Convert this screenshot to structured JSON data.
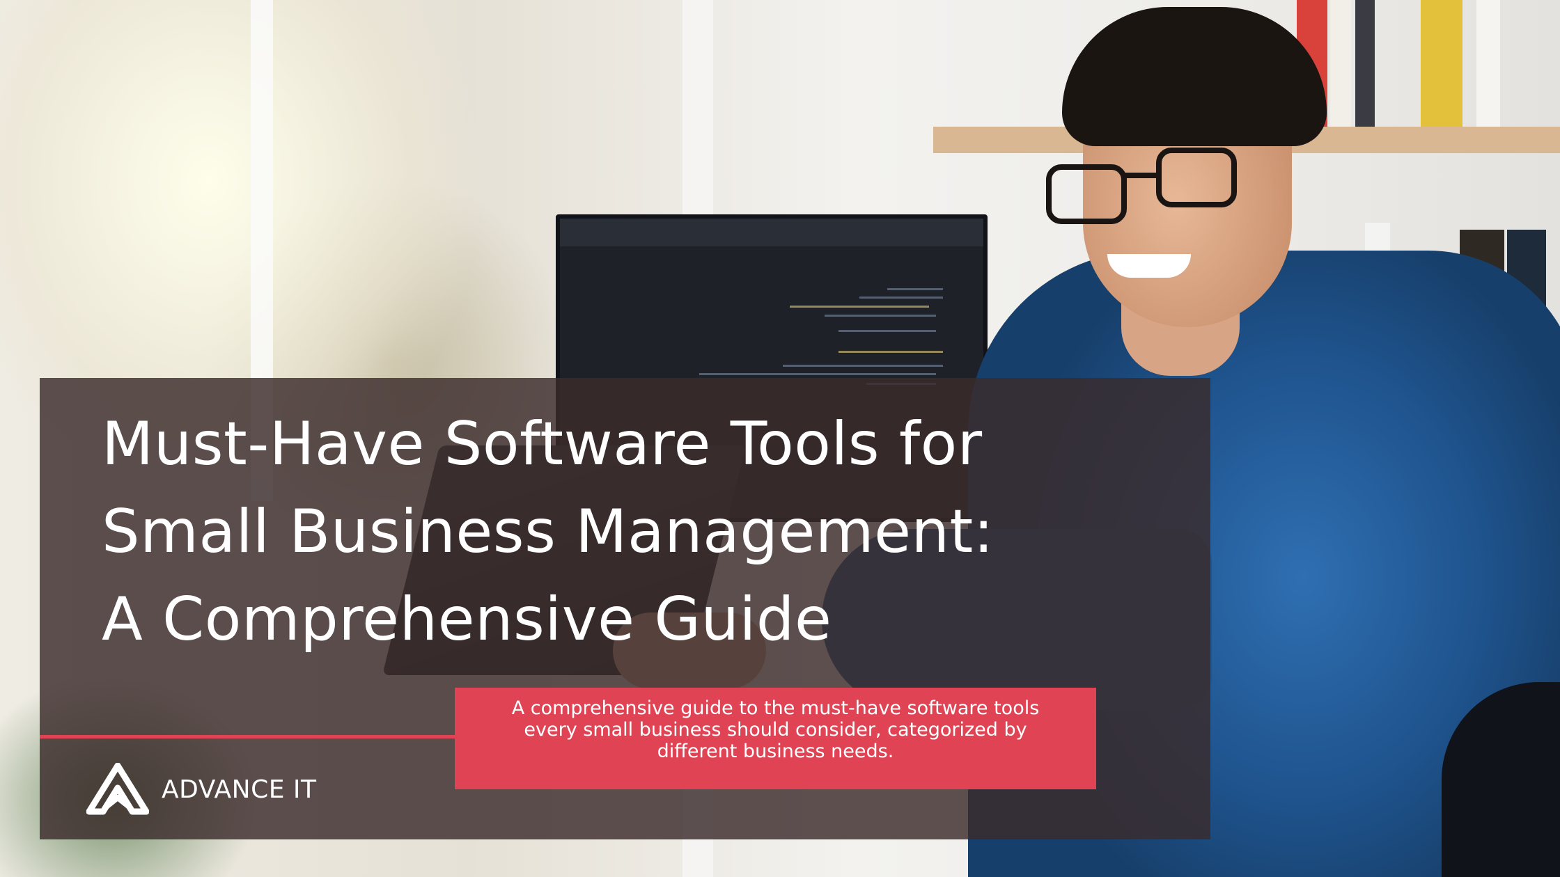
{
  "title": {
    "line1": "Must-Have Software Tools for",
    "line2": "Small Business Management:",
    "line3": "A Comprehensive Guide"
  },
  "subtitle": "A comprehensive guide to the must-have software tools every small business should consider, categorized by different business needs.",
  "brand": {
    "name": "ADVANCE IT",
    "logo_icon": "advance-it-logo-icon"
  },
  "colors": {
    "accent": "#e04454",
    "panel_overlay": "#3a2b2b",
    "text": "#ffffff"
  },
  "background_image": "photo-young-man-with-glasses-at-desk-with-computer-monitor-and-laptop"
}
